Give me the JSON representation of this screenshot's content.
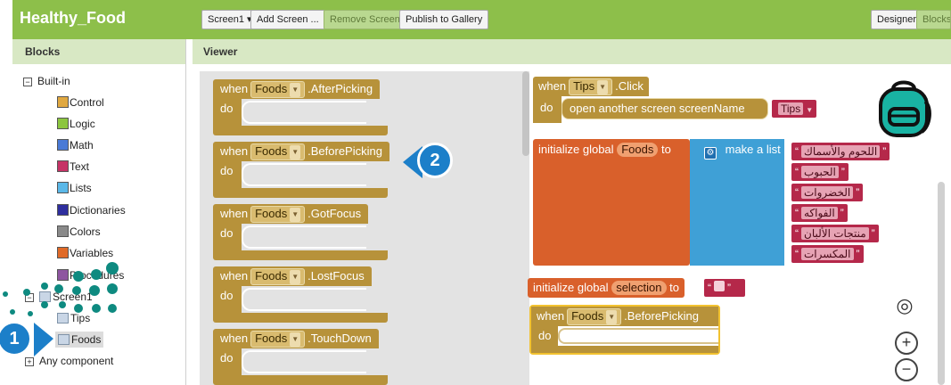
{
  "app_title": "Healthy_Food",
  "toolbar": {
    "screen_select": "Screen1",
    "screen_select_arrow": "▾",
    "add_screen": "Add Screen ...",
    "remove_screen": "Remove Screen",
    "publish": "Publish to Gallery",
    "designer": "Designer",
    "blocks": "Blocks"
  },
  "blocks_panel": {
    "header": "Blocks",
    "builtin_label": "Built-in",
    "builtin_toggle": "−",
    "categories": [
      {
        "label": "Control",
        "color": "#e0a840"
      },
      {
        "label": "Logic",
        "color": "#8cc63f"
      },
      {
        "label": "Math",
        "color": "#4a7ad6"
      },
      {
        "label": "Text",
        "color": "#c63366"
      },
      {
        "label": "Lists",
        "color": "#5bb8e8"
      },
      {
        "label": "Dictionaries",
        "color": "#2e2e9e"
      },
      {
        "label": "Colors",
        "color": "#8a8a8a"
      },
      {
        "label": "Variables",
        "color": "#e06a28"
      },
      {
        "label": "Procedures",
        "color": "#8e55a0"
      }
    ],
    "screen_item": "Screen1",
    "screen_toggle": "−",
    "components": [
      "Tips",
      "Foods"
    ],
    "any_component": "Any component",
    "any_toggle": "+"
  },
  "viewer": {
    "header": "Viewer"
  },
  "drawer_blocks": [
    {
      "when": "when",
      "component": "Foods",
      "event": ".AfterPicking",
      "do": "do"
    },
    {
      "when": "when",
      "component": "Foods",
      "event": ".BeforePicking",
      "do": "do"
    },
    {
      "when": "when",
      "component": "Foods",
      "event": ".GotFocus",
      "do": "do"
    },
    {
      "when": "when",
      "component": "Foods",
      "event": ".LostFocus",
      "do": "do"
    },
    {
      "when": "when",
      "component": "Foods",
      "event": ".TouchDown",
      "do": "do"
    }
  ],
  "workspace": {
    "tips_click": {
      "when": "when",
      "component": "Tips",
      "event": ".Click",
      "do": "do",
      "action": "open another screen  screenName",
      "value": "Tips"
    },
    "init_foods": {
      "label": "initialize global",
      "var": "Foods",
      "to": "to",
      "make_list": "make a list",
      "items": [
        "اللحوم والأسماك",
        "الحبوب",
        "الخضروات",
        "الفواكه",
        "منتجات الألبان",
        "المكسرات"
      ]
    },
    "init_selection": {
      "label": "initialize global",
      "var": "selection",
      "to": "to"
    },
    "before_picking": {
      "when": "when",
      "component": "Foods",
      "event": ".BeforePicking",
      "do": "do"
    },
    "controls": {
      "target": "◎",
      "zoom_in": "+",
      "zoom_out": "−"
    }
  },
  "callouts": {
    "one": "1",
    "two": "2"
  },
  "colors": {
    "topbar": "#8dbf4a",
    "callout": "#1c7fc9",
    "event_block": "#b7923a"
  }
}
